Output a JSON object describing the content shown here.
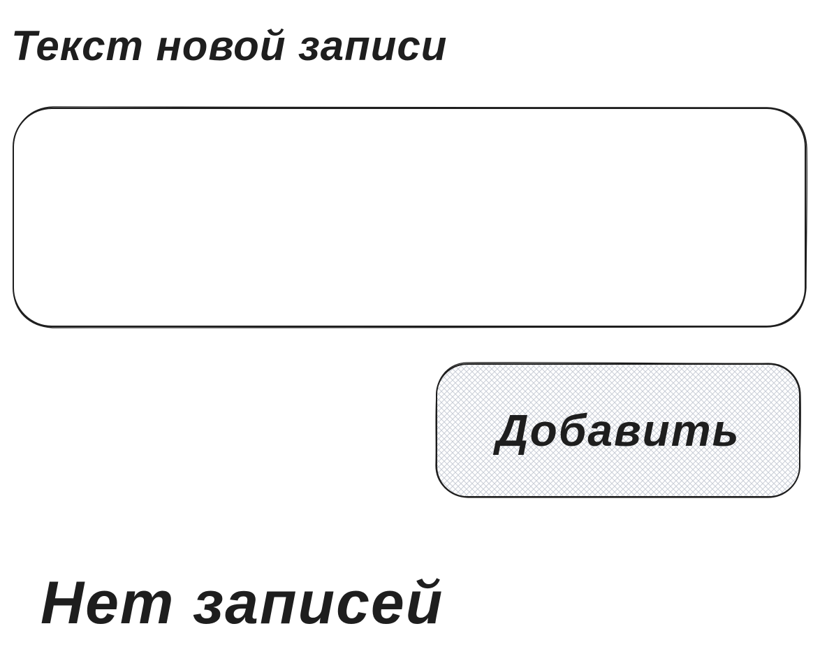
{
  "form": {
    "title": "Текст новой записи",
    "input_value": "",
    "add_button_label": "Добавить"
  },
  "entries": {
    "empty_message": "Нет записей"
  },
  "colors": {
    "stroke": "#1e1e1e",
    "background": "#ffffff",
    "hatch": "#c9ced6"
  }
}
